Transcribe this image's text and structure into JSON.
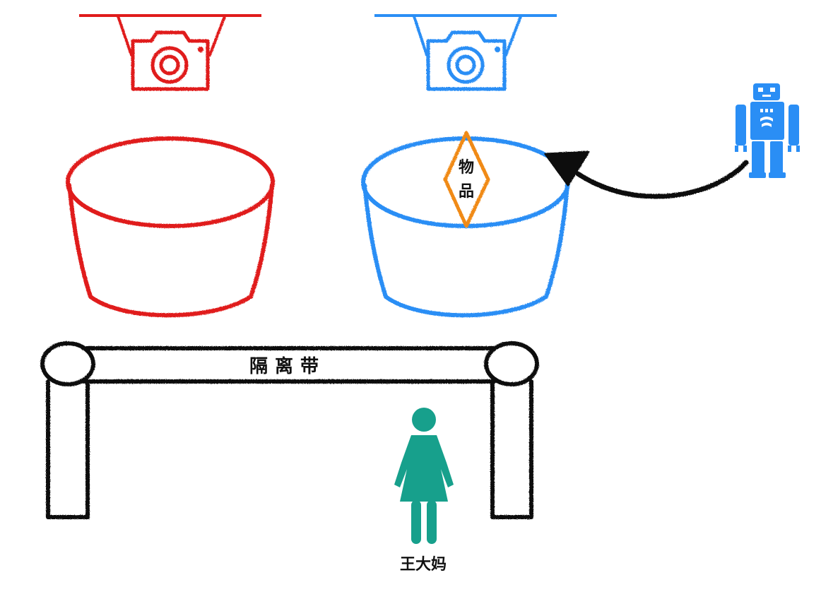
{
  "diagram": {
    "labels": {
      "item": "物品",
      "barrier": "隔离带",
      "person": "王大妈"
    },
    "icons": {
      "left_camera": "camera-icon",
      "right_camera": "camera-icon",
      "robot": "robot-icon",
      "person": "woman-icon"
    },
    "colors": {
      "red": "#e01b1b",
      "blue": "#2a8ef5",
      "orange": "#f08a19",
      "teal": "#17a08c",
      "black": "#111111"
    }
  }
}
